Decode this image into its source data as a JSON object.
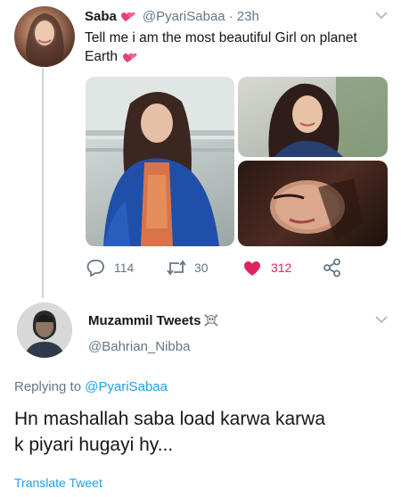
{
  "tweet": {
    "name": "Saba",
    "handle": "@PyariSabaa",
    "time": "· 23h",
    "text_line1": "Tell me i am the most beautiful Girl on planet",
    "text_line2": "Earth",
    "actions": {
      "replies": "114",
      "retweets": "30",
      "likes": "312"
    },
    "like_color": "#e0245e"
  },
  "reply": {
    "name": "Muzammil Tweets",
    "handle": "@Bahrian_Nibba",
    "replying_prefix": "Replying to",
    "replying_to": "@PyariSabaa",
    "text_line1": "Hn mashallah saba load karwa karwa",
    "text_line2": "k piyari hugayi hy...",
    "translate": "Translate Tweet"
  },
  "colors": {
    "link": "#1da1f2",
    "muted": "#657786",
    "thread_line": "#ccd6dd"
  },
  "icons": [
    "heart-emoji-icon",
    "chevron-down-icon",
    "reply-icon",
    "retweet-icon",
    "like-icon",
    "share-icon",
    "skull-crossbones-icon"
  ]
}
